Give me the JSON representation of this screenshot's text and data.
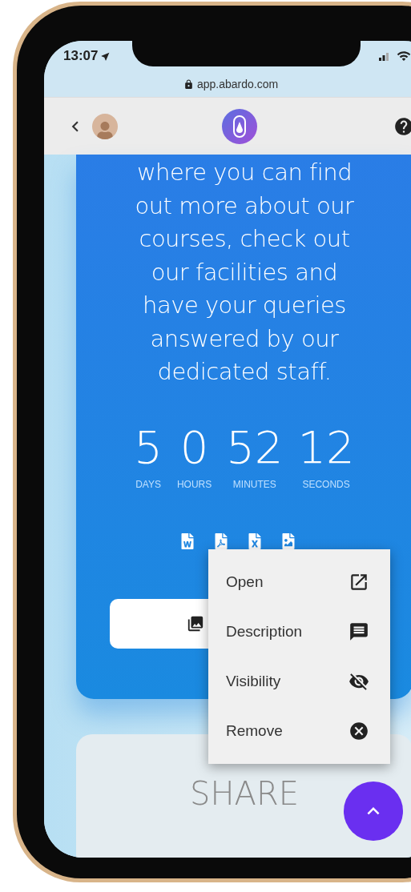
{
  "status_bar": {
    "time": "13:07"
  },
  "url_bar": {
    "url": "app.abardo.com"
  },
  "card": {
    "text": "where you can find out more about our courses, check out our facilities and have your queries answered by our dedicated staff.",
    "countdown": [
      {
        "value": "5",
        "label": "DAYS"
      },
      {
        "value": "0",
        "label": "HOURS"
      },
      {
        "value": "52",
        "label": "MINUTES"
      },
      {
        "value": "12",
        "label": "SECONDS"
      }
    ],
    "files": [
      {
        "kind": "word"
      },
      {
        "kind": "pdf"
      },
      {
        "kind": "excel"
      },
      {
        "kind": "image"
      }
    ]
  },
  "menu": {
    "items": [
      {
        "label": "Open",
        "kind": "open"
      },
      {
        "label": "Description",
        "kind": "description"
      },
      {
        "label": "Visibility",
        "kind": "visibility"
      },
      {
        "label": "Remove",
        "kind": "remove"
      }
    ]
  },
  "share": {
    "title": "SHARE"
  }
}
